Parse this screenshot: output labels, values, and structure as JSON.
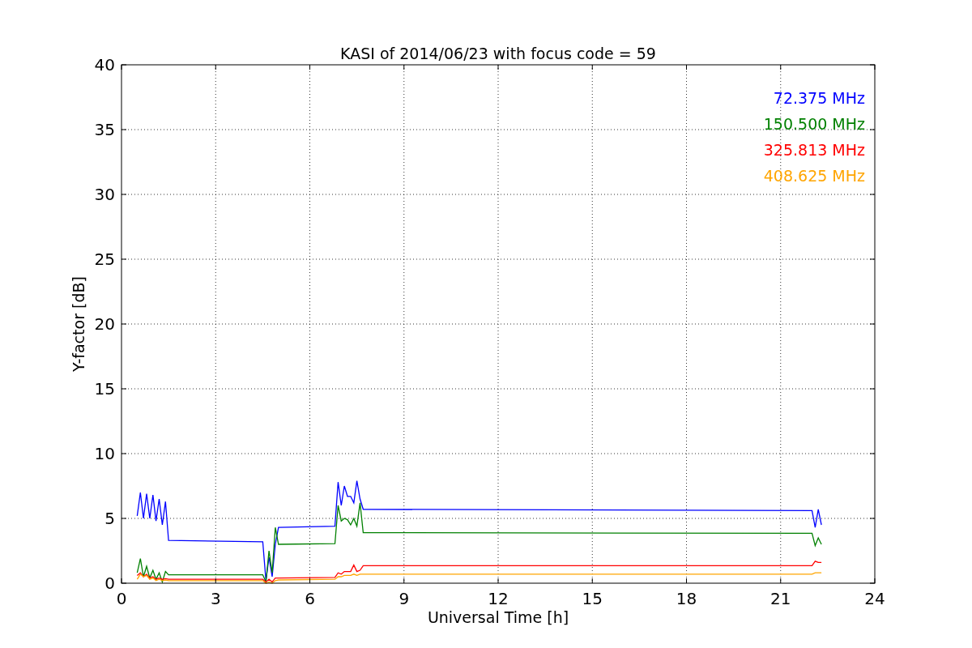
{
  "chart_data": {
    "type": "line",
    "title": "KASI of 2014/06/23 with focus code = 59",
    "xlabel": "Universal Time [h]",
    "ylabel": "Y-factor [dB]",
    "x": [
      0.5,
      0.6,
      0.7,
      0.8,
      0.9,
      1.0,
      1.1,
      1.2,
      1.3,
      1.4,
      1.5,
      4.5,
      4.6,
      4.7,
      4.8,
      4.9,
      5.0,
      6.8,
      6.9,
      7.0,
      7.1,
      7.2,
      7.3,
      7.4,
      7.5,
      7.6,
      7.7,
      22.0,
      22.1,
      22.2,
      22.3
    ],
    "series": [
      {
        "name": "72.375 MHz",
        "color": "#0000ff",
        "values": [
          5.2,
          7.0,
          5.0,
          6.9,
          5.0,
          6.8,
          4.8,
          6.5,
          4.5,
          6.3,
          3.3,
          3.2,
          0.2,
          2.0,
          0.5,
          3.0,
          4.3,
          4.4,
          7.8,
          6.0,
          7.5,
          6.7,
          6.7,
          6.2,
          7.9,
          6.5,
          5.7,
          5.6,
          4.3,
          5.7,
          4.5
        ]
      },
      {
        "name": "150.500 MHz",
        "color": "#008000",
        "values": [
          0.8,
          1.9,
          0.5,
          1.3,
          0.4,
          1.0,
          0.3,
          0.8,
          0.1,
          0.9,
          0.65,
          0.65,
          0.1,
          2.5,
          0.8,
          4.3,
          3.0,
          3.05,
          6.0,
          4.8,
          5.0,
          4.9,
          4.5,
          5.0,
          4.4,
          6.2,
          3.9,
          3.85,
          2.9,
          3.5,
          3.0
        ]
      },
      {
        "name": "325.813 MHz",
        "color": "#ff0000",
        "values": [
          0.6,
          0.8,
          0.5,
          0.7,
          0.4,
          0.5,
          0.3,
          0.4,
          0.3,
          0.35,
          0.3,
          0.3,
          0.1,
          0.3,
          0.1,
          0.4,
          0.4,
          0.45,
          0.8,
          0.7,
          0.9,
          0.9,
          0.9,
          1.4,
          0.9,
          1.0,
          1.35,
          1.35,
          1.7,
          1.6,
          1.6
        ]
      },
      {
        "name": "408.625 MHz",
        "color": "#ffa500",
        "values": [
          0.3,
          0.7,
          0.5,
          0.6,
          0.3,
          0.4,
          0.2,
          0.3,
          0.2,
          0.25,
          0.2,
          0.2,
          0.0,
          0.1,
          0.0,
          0.2,
          0.25,
          0.3,
          0.5,
          0.5,
          0.6,
          0.6,
          0.6,
          0.7,
          0.6,
          0.7,
          0.7,
          0.7,
          0.8,
          0.8,
          0.8
        ]
      }
    ],
    "xlim": [
      0,
      24
    ],
    "ylim": [
      0,
      40
    ],
    "xticks": [
      0,
      3,
      6,
      9,
      12,
      15,
      18,
      21,
      24
    ],
    "yticks": [
      0,
      5,
      10,
      15,
      20,
      25,
      30,
      35,
      40
    ],
    "grid": true
  }
}
